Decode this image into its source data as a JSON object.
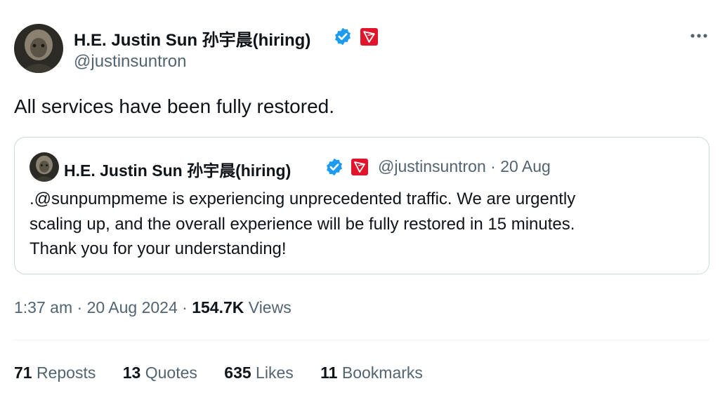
{
  "author": {
    "name": "H.E. Justin Sun 孙宇晨(hiring)",
    "handle": "@justinsuntron"
  },
  "tweet": {
    "text": "All services have been fully restored.",
    "time": "1:37 am",
    "date": "20 Aug 2024",
    "views_count": "154.7K",
    "views_label": "Views"
  },
  "quote": {
    "author_name": "H.E. Justin Sun 孙宇晨(hiring)",
    "handle": "@justinsuntron",
    "date": "20 Aug",
    "lines": [
      ".@sunpumpmeme is experiencing unprecedented traffic. We are urgently",
      "scaling up, and the overall experience will be fully restored in 15 minutes.",
      "Thank you for your understanding!"
    ]
  },
  "stats": {
    "reposts_count": "71",
    "reposts_label": "Reposts",
    "quotes_count": "13",
    "quotes_label": "Quotes",
    "likes_count": "635",
    "likes_label": "Likes",
    "bookmarks_count": "11",
    "bookmarks_label": "Bookmarks"
  },
  "separator": "·",
  "icons": {
    "verified": "verified-badge-icon",
    "affiliate": "tron-affiliate-icon",
    "more": "more-options-icon"
  },
  "colors": {
    "text_primary": "#0f1419",
    "text_secondary": "#536471",
    "verified_blue": "#1d9bf0",
    "affiliate_red": "#e0142a",
    "border": "#cfd9de"
  }
}
